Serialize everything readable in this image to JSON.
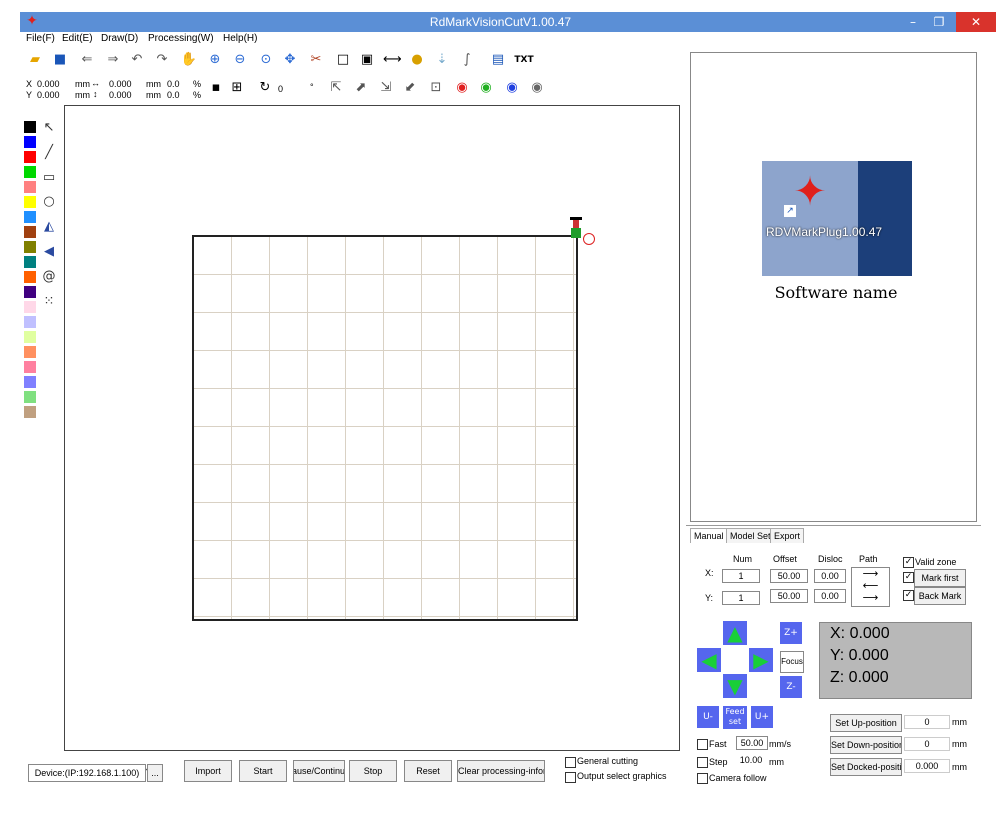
{
  "window": {
    "title": "RdMarkVisionCutV1.00.47",
    "minimize_glyph": "–",
    "restore_glyph": "❐",
    "close_glyph": "✕"
  },
  "menu": [
    "File(F)",
    "Edit(E)",
    "Draw(D)",
    "Processing(W)",
    "Help(H)"
  ],
  "toolbar": {
    "icons": [
      "open-icon",
      "save-icon",
      "import-icon",
      "export-icon",
      "undo-icon",
      "redo-icon",
      "pan-icon",
      "zoom-in-icon",
      "zoom-out-icon",
      "zoom-fit-icon",
      "node-edit-icon",
      "cut-icon",
      "rectangle-select-icon",
      "group-icon",
      "distance-icon",
      "light-icon",
      "path-icon",
      "curve-icon",
      "camera-icon"
    ],
    "txt_label": "TXT"
  },
  "position": {
    "x_label": "X",
    "y_label": "Y",
    "x_value": "0.000",
    "y_value": "0.000",
    "unit": "mm",
    "w_value": "0.000",
    "h_value": "0.000",
    "sx_value": "0.0",
    "sy_value": "0.0",
    "percent": "%",
    "rotate_value": "0",
    "degree": "°"
  },
  "palette": {
    "colors": [
      "#000000",
      "#0000ff",
      "#ff0000",
      "#00d800",
      "#ff8080",
      "#ffff00",
      "#2090ff",
      "#a04010",
      "#808000",
      "#008080",
      "#ff6000",
      "#400080",
      "#ffd8e8",
      "#c0c0ff",
      "#e0ffa0",
      "#ff9060",
      "#ff80a0",
      "#8080ff",
      "#80e080",
      "#c0a080"
    ]
  },
  "preview": {
    "icon_label": "RDVMarkPlug1.00.47",
    "caption": "Software name"
  },
  "panel": {
    "tabs": [
      "Manual",
      "Model Set",
      "Export"
    ],
    "headers": {
      "num": "Num",
      "offset": "Offset",
      "disloc": "Disloc",
      "path": "Path"
    },
    "x_label": "X:",
    "y_label": "Y:",
    "x_num": "1",
    "x_offset": "50.00",
    "x_disloc": "0.00",
    "y_num": "1",
    "y_offset": "50.00",
    "y_disloc": "0.00",
    "valid_zone": "Valid zone",
    "mark_first": "Mark first",
    "back_mark": "Back Mark",
    "z_plus": "Z+",
    "z_minus": "Z-",
    "focus": "Focus",
    "u_minus": "U-",
    "u_plus": "U+",
    "feed_set": "Feed set",
    "coord_x": "X:  0.000",
    "coord_y": "Y:  0.000",
    "coord_z": "Z:  0.000",
    "set_up": "Set Up-position",
    "set_down": "Set Down-position",
    "set_docked": "Set Docked-position",
    "up_value": "0",
    "down_value": "0",
    "docked_value": "0.000",
    "unit_mm": "mm",
    "fast": "Fast",
    "step": "Step",
    "camera_follow": "Camera follow",
    "speed_value": "50.00",
    "speed_unit": "mm/s",
    "step_value": "10.00",
    "step_unit": "mm"
  },
  "bottom": {
    "device": "Device:(IP:192.168.1.100)",
    "more": "...",
    "import": "Import",
    "start": "Start",
    "pause": "Pause/Continue",
    "stop": "Stop",
    "reset": "Reset",
    "clear": "Clear processing-infor",
    "general_cutting": "General cutting",
    "output_select": "Output select graphics"
  }
}
